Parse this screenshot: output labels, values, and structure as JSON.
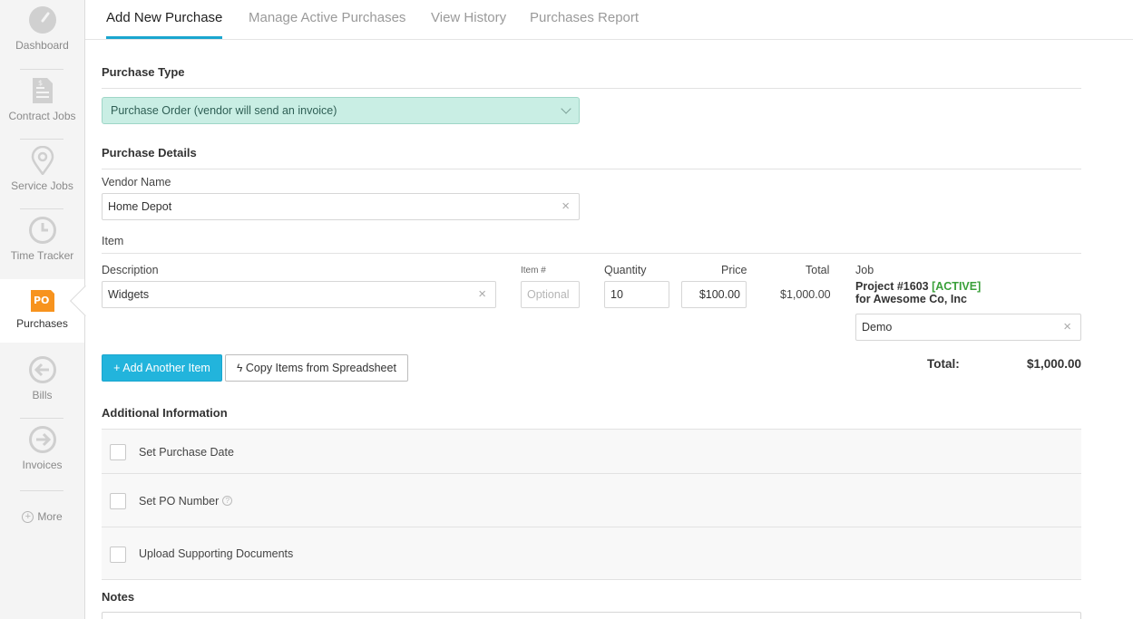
{
  "sidebar": {
    "items": [
      {
        "label": "Dashboard",
        "icon": "gauge-icon"
      },
      {
        "label": "Contract Jobs",
        "icon": "dollar-document-icon"
      },
      {
        "label": "Service Jobs",
        "icon": "map-pin-icon"
      },
      {
        "label": "Time Tracker",
        "icon": "clock-icon"
      },
      {
        "label": "Purchases",
        "icon": "po-icon",
        "badge": "PO",
        "active": true
      },
      {
        "label": "Bills",
        "icon": "arrow-left-circle-icon"
      },
      {
        "label": "Invoices",
        "icon": "arrow-right-circle-icon"
      }
    ],
    "more_label": "More"
  },
  "tabs": [
    {
      "label": "Add New Purchase",
      "active": true
    },
    {
      "label": "Manage Active Purchases"
    },
    {
      "label": "View History"
    },
    {
      "label": "Purchases Report"
    }
  ],
  "purchase_type": {
    "title": "Purchase Type",
    "selected": "Purchase Order (vendor will send an invoice)"
  },
  "purchase_details": {
    "title": "Purchase Details",
    "vendor_label": "Vendor Name",
    "vendor_value": "Home Depot"
  },
  "item": {
    "title": "Item",
    "headers": {
      "description": "Description",
      "item_number": "Item #",
      "quantity": "Quantity",
      "price": "Price",
      "total": "Total",
      "job": "Job"
    },
    "row": {
      "description": "Widgets",
      "item_number_placeholder": "Optional",
      "quantity": "10",
      "price": "$100.00",
      "total": "$1,000.00",
      "job_project": "Project #1603",
      "job_status": "[ACTIVE]",
      "job_client": "for Awesome Co, Inc",
      "job_search": "Demo"
    },
    "add_button": "+ Add Another Item",
    "copy_button": "Copy Items from Spreadsheet",
    "grand_total_label": "Total:",
    "grand_total_value": "$1,000.00"
  },
  "additional": {
    "title": "Additional Information",
    "options": [
      {
        "label": "Set Purchase Date"
      },
      {
        "label": "Set PO Number",
        "help": "?"
      },
      {
        "label": "Upload Supporting Documents"
      }
    ]
  },
  "notes": {
    "title": "Notes"
  },
  "colors": {
    "accent": "#1aa6cf",
    "po_orange": "#f7931e",
    "select_bg": "#c9eee4",
    "active_green": "#3aa03a"
  }
}
